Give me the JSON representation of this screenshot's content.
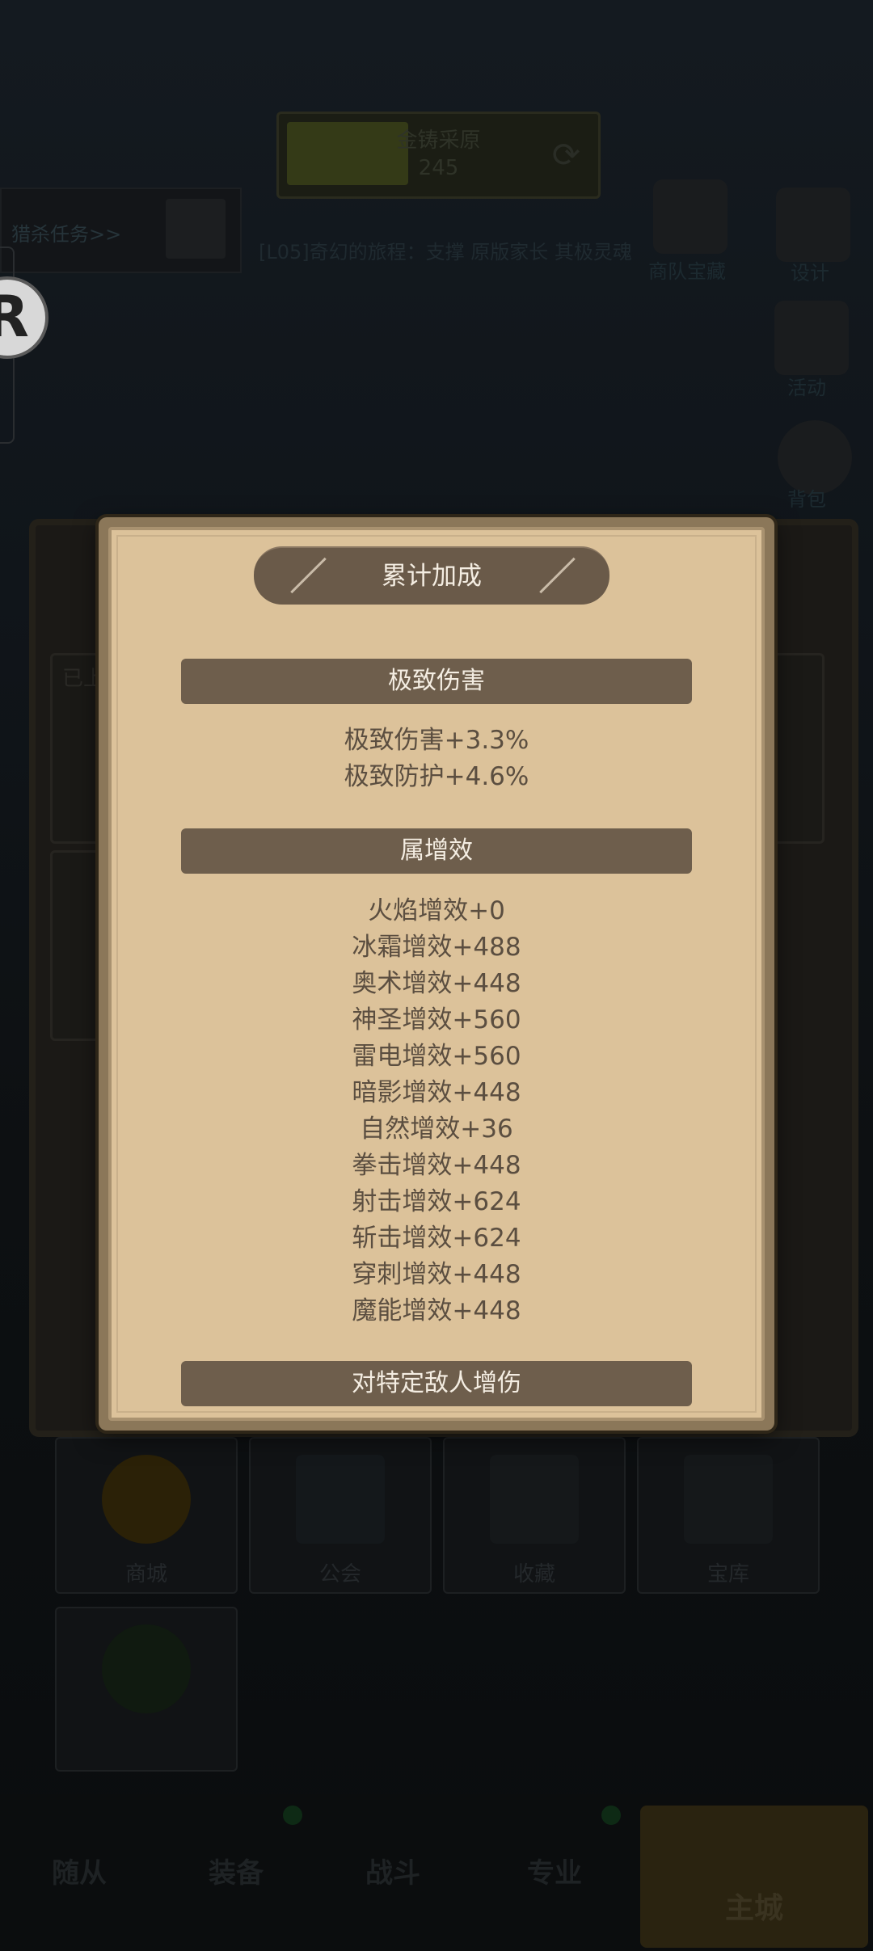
{
  "background": {
    "resource": {
      "title": "金铸采原",
      "count": "245"
    },
    "task": {
      "label": "猎杀任务>>"
    },
    "scroll_text": "[L05]奇幻的旅程：支撑 原版家长 其极灵魂",
    "side_labels": [
      "商队宝藏",
      "设计",
      "活动",
      "背包"
    ],
    "grid": [
      {
        "label": "商城"
      },
      {
        "label": "公会"
      },
      {
        "label": "收藏"
      },
      {
        "label": "宝库"
      }
    ],
    "under_tags": [
      "已上"
    ],
    "nav": {
      "items": [
        "随从",
        "装备",
        "战斗",
        "专业"
      ],
      "home": "主城"
    }
  },
  "dialog": {
    "title": "累计加成",
    "sections": [
      {
        "header": "极致伤害",
        "lines": [
          "极致伤害+3.3%",
          "极致防护+4.6%"
        ]
      },
      {
        "header": "属增效",
        "lines": [
          "火焰增效+0",
          "冰霜增效+488",
          "奥术增效+448",
          "神圣增效+560",
          "雷电增效+560",
          "暗影增效+448",
          "自然增效+36",
          "拳击增效+448",
          "射击增效+624",
          "斩击增效+624",
          "穿刺增效+448",
          "魔能增效+448"
        ]
      },
      {
        "header": "对特定敌人增伤",
        "lines": []
      }
    ]
  }
}
